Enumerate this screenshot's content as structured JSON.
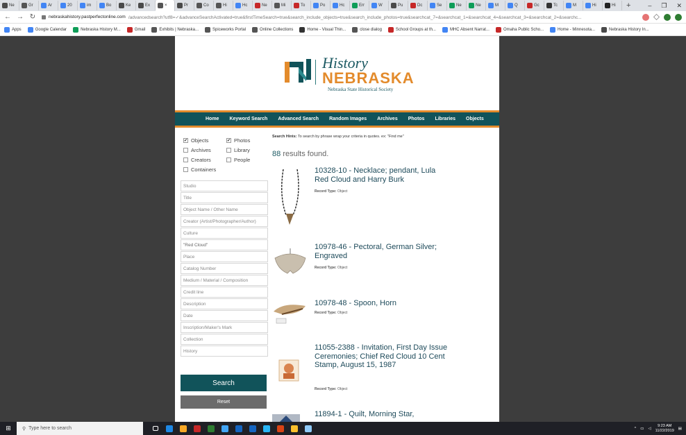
{
  "browser": {
    "tabs": [
      {
        "label": "Ne",
        "color": "#4a4a4a"
      },
      {
        "label": "Gr",
        "color": "#555555"
      },
      {
        "label": "Ar",
        "color": "#4285f4"
      },
      {
        "label": "20",
        "color": "#4285f4"
      },
      {
        "label": "im",
        "color": "#4285f4"
      },
      {
        "label": "Bo",
        "color": "#4285f4"
      },
      {
        "label": "Ke",
        "color": "#4a4a4a"
      },
      {
        "label": "Ex",
        "color": "#4a4a4a"
      },
      {
        "label": "×",
        "color": "#555555",
        "active": true
      },
      {
        "label": "Pr",
        "color": "#4a4a4a"
      },
      {
        "label": "Co",
        "color": "#555555"
      },
      {
        "label": "Hi",
        "color": "#555555"
      },
      {
        "label": "Hc",
        "color": "#4285f4"
      },
      {
        "label": "Ne",
        "color": "#c62828"
      },
      {
        "label": "Mi",
        "color": "#555555"
      },
      {
        "label": "To",
        "color": "#c62828"
      },
      {
        "label": "Po",
        "color": "#4285f4"
      },
      {
        "label": "Hc",
        "color": "#4285f4"
      },
      {
        "label": "Err",
        "color": "#0f9d58"
      },
      {
        "label": "W",
        "color": "#4285f4"
      },
      {
        "label": "Pu",
        "color": "#4a4a4a"
      },
      {
        "label": "Dc",
        "color": "#c62828"
      },
      {
        "label": "Se",
        "color": "#4285f4"
      },
      {
        "label": "Ne",
        "color": "#0f9d58"
      },
      {
        "label": "Ne",
        "color": "#0f9d58"
      },
      {
        "label": "M",
        "color": "#4285f4"
      },
      {
        "label": "Q",
        "color": "#4285f4"
      },
      {
        "label": "Gc",
        "color": "#c62828"
      },
      {
        "label": "Tc",
        "color": "#333333"
      },
      {
        "label": "M",
        "color": "#4285f4"
      },
      {
        "label": "Hi",
        "color": "#4285f4"
      },
      {
        "label": "Hi",
        "color": "#222222"
      }
    ],
    "new_tab": "+",
    "window_controls": [
      "–",
      "❐",
      "✕"
    ],
    "url_host": "nebraskahistory.pastperfectonline.com",
    "url_path": "/advancedsearch?utf8=✓&advanceSearchActivated=true&firstTimeSearch=true&search_include_objects=true&search_include_photos=true&searchcat_7=&searchcat_1=&searchcat_4=&searchcat_3=&searchcat_2=&searchc...",
    "bookmarks": [
      {
        "label": "Apps",
        "color": "#4285f4"
      },
      {
        "label": "Google Calendar",
        "color": "#4285f4"
      },
      {
        "label": "Nebraska History M...",
        "color": "#0f9d58"
      },
      {
        "label": "Gmail",
        "color": "#c62828"
      },
      {
        "label": "Exhibits | Nebraska...",
        "color": "#555555"
      },
      {
        "label": "Spiceworks Portal",
        "color": "#555555"
      },
      {
        "label": "Online Collections",
        "color": "#555555"
      },
      {
        "label": "Home - Visual Thin...",
        "color": "#333333"
      },
      {
        "label": "close dialog",
        "color": "#555555"
      },
      {
        "label": "School Groups at th...",
        "color": "#c62828"
      },
      {
        "label": "MHC Absent Narrat...",
        "color": "#4285f4"
      },
      {
        "label": "Omaha Public Scho...",
        "color": "#c62828"
      },
      {
        "label": "Home - Minnesota...",
        "color": "#4285f4"
      },
      {
        "label": "Nebraska History In...",
        "color": "#4a4a4a"
      }
    ]
  },
  "site": {
    "logo_history": "History",
    "logo_nebraska": "NEBRASKA",
    "logo_subtitle": "Nebraska State Historical Society",
    "nav": [
      "Home",
      "Keyword Search",
      "Advanced Search",
      "Random Images",
      "Archives",
      "Photos",
      "Libraries",
      "Objects"
    ]
  },
  "filters": {
    "checkboxes": [
      {
        "label": "Objects",
        "checked": true
      },
      {
        "label": "Photos",
        "checked": true
      },
      {
        "label": "Archives",
        "checked": false
      },
      {
        "label": "Library",
        "checked": false
      },
      {
        "label": "Creators",
        "checked": false
      },
      {
        "label": "People",
        "checked": false
      },
      {
        "label": "Containers",
        "checked": false
      }
    ],
    "fields": [
      {
        "placeholder": "Studio",
        "value": ""
      },
      {
        "placeholder": "Title",
        "value": ""
      },
      {
        "placeholder": "Object Name / Other Name",
        "value": ""
      },
      {
        "placeholder": "Creator (Artist/Photographer/Author)",
        "value": ""
      },
      {
        "placeholder": "Culture",
        "value": ""
      },
      {
        "placeholder": "",
        "value": "\"Red Cloud\""
      },
      {
        "placeholder": "Place",
        "value": ""
      },
      {
        "placeholder": "Catalog Number",
        "value": ""
      },
      {
        "placeholder": "Medium / Material / Composition",
        "value": ""
      },
      {
        "placeholder": "Credit line",
        "value": ""
      },
      {
        "placeholder": "Description",
        "value": ""
      },
      {
        "placeholder": "Date",
        "value": ""
      },
      {
        "placeholder": "Inscription/Maker's Mark",
        "value": ""
      },
      {
        "placeholder": "Collection",
        "value": ""
      },
      {
        "placeholder": "History",
        "value": ""
      }
    ],
    "search_label": "Search",
    "reset_label": "Reset"
  },
  "results": {
    "hints_label": "Search Hints:",
    "hints_text": "To search by phrase wrap your criteria in quotes. ex: \"Find me\"",
    "count": "88",
    "count_suffix": "results found.",
    "record_type_label": "Record Type:",
    "items": [
      {
        "title": "10328-10 - Necklace; pendant, Lula Red Cloud and Harry Burk",
        "record_type": "Object",
        "thumb": "necklace-image"
      },
      {
        "title": "10978-46 - Pectoral, German Silver; Engraved",
        "record_type": "Object",
        "thumb": "pectoral-image"
      },
      {
        "title": "10978-48 - Spoon, Horn",
        "record_type": "Object",
        "thumb": "spoon-image"
      },
      {
        "title": "11055-2388 - Invitation, First Day Issue Ceremonies; Chief Red Cloud 10 Cent Stamp, August 15, 1987",
        "record_type": "Object",
        "thumb": "stamp-image"
      },
      {
        "title": "11894-1 - Quilt, Morning Star,",
        "record_type": "",
        "thumb": "quilt-image"
      }
    ]
  },
  "taskbar": {
    "search_placeholder": "Type here to search",
    "time": "9:23 AM",
    "date": "11/22/2019",
    "apps": [
      {
        "name": "task-view-icon",
        "color": "#ffffff"
      },
      {
        "name": "edge-icon",
        "color": "#1e88e5"
      },
      {
        "name": "file-explorer-icon",
        "color": "#f9a825"
      },
      {
        "name": "access-icon",
        "color": "#c62828"
      },
      {
        "name": "excel-icon",
        "color": "#2e7d32"
      },
      {
        "name": "ie-icon",
        "color": "#42a5f5"
      },
      {
        "name": "outlook-icon",
        "color": "#1565c0"
      },
      {
        "name": "word-icon",
        "color": "#1565c0"
      },
      {
        "name": "skype-icon",
        "color": "#29b6f6"
      },
      {
        "name": "powerpoint-icon",
        "color": "#d84315"
      },
      {
        "name": "chrome-icon",
        "color": "#fbc02d"
      },
      {
        "name": "photos-icon",
        "color": "#90caf9"
      }
    ]
  },
  "colors": {
    "brand_teal": "#11535a",
    "brand_orange": "#e38b2c",
    "title_blue": "#1d4a5a"
  }
}
